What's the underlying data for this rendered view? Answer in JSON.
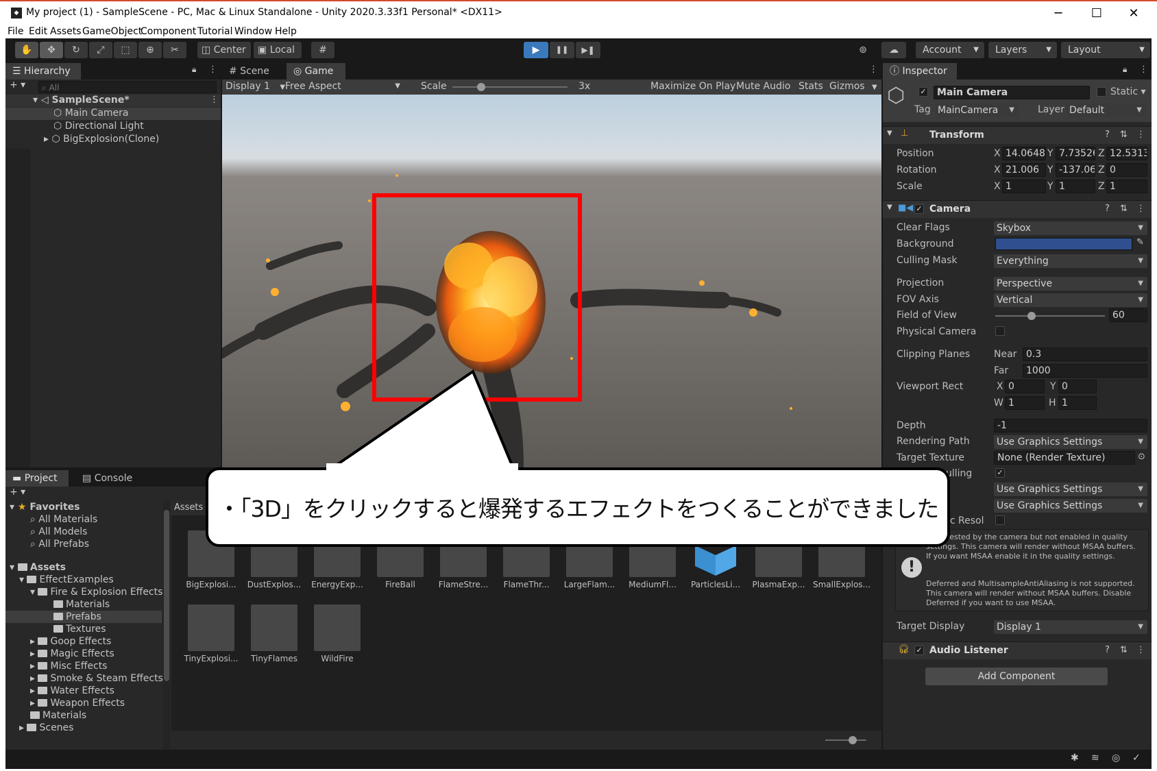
{
  "window": {
    "title": "My project (1) - SampleScene - PC, Mac & Linux Standalone - Unity 2020.3.33f1 Personal* <DX11>",
    "app_icon": "unity-logo-icon",
    "controls": [
      "─",
      "☐",
      "✕"
    ]
  },
  "menu": [
    "File",
    "Edit",
    "Assets",
    "GameObject",
    "Component",
    "Tutorial",
    "Window",
    "Help"
  ],
  "toolbar": {
    "tools": [
      "hand-tool-icon",
      "move-tool-icon",
      "rotate-tool-icon",
      "scale-tool-icon",
      "rect-tool-icon",
      "transform-tool-icon",
      "custom-tool-icon"
    ],
    "pivot": "Center",
    "space": "Local",
    "play_icon": "▶",
    "pause_icon": "❚❚",
    "step_icon": "▶❚",
    "account": "Account",
    "layers": "Layers",
    "layout": "Layout"
  },
  "hierarchy": {
    "tab": "Hierarchy",
    "search_placeholder": "All",
    "scene": "SampleScene*",
    "items": [
      "Main Camera",
      "Directional Light",
      "BigExplosion(Clone)"
    ]
  },
  "game_view": {
    "tabs": [
      "Scene",
      "Game"
    ],
    "display": "Display 1",
    "aspect": "Free Aspect",
    "scale_label": "Scale",
    "scale_value": "3x",
    "scale_level": 0.25,
    "options": [
      "Maximize On Play",
      "Mute Audio",
      "Stats",
      "Gizmos"
    ]
  },
  "project": {
    "tabs": [
      "Project",
      "Console"
    ],
    "favorites_label": "Favorites",
    "favorites": [
      "All Materials",
      "All Models",
      "All Prefabs"
    ],
    "assets_label": "Assets",
    "tree": [
      {
        "label": "EffectExamples",
        "depth": 1
      },
      {
        "label": "Fire & Explosion Effects",
        "depth": 2
      },
      {
        "label": "Materials",
        "depth": 3
      },
      {
        "label": "Prefabs",
        "depth": 3
      },
      {
        "label": "Textures",
        "depth": 3
      },
      {
        "label": "Goop Effects",
        "depth": 2
      },
      {
        "label": "Magic Effects",
        "depth": 2
      },
      {
        "label": "Misc Effects",
        "depth": 2
      },
      {
        "label": "Smoke & Steam Effects",
        "depth": 2
      },
      {
        "label": "Water Effects",
        "depth": 2
      },
      {
        "label": "Weapon Effects",
        "depth": 2
      },
      {
        "label": "Materials",
        "depth": 1
      },
      {
        "label": "Scenes",
        "depth": 1
      }
    ],
    "breadcrumb": "Assets",
    "assets_row1": [
      "BigExplosi...",
      "DustExplos...",
      "EnergyExp...",
      "FireBall",
      "FlameStre...",
      "FlameThr...",
      "LargeFlam...",
      "MediumFl...",
      "ParticlesLi...",
      "PlasmaExp...",
      "SmallExplos..."
    ],
    "assets_row2": [
      "TinyExplosi...",
      "TinyFlames",
      "WildFire"
    ]
  },
  "inspector": {
    "tab": "Inspector",
    "object_name": "Main Camera",
    "static_label": "Static",
    "tag_label": "Tag",
    "tag_value": "MainCamera",
    "layer_label": "Layer",
    "layer_value": "Default",
    "transform": {
      "title": "Transform",
      "position_label": "Position",
      "rotation_label": "Rotation",
      "scale_label": "Scale",
      "position": [
        "14.0648",
        "7.73526",
        "12.5313"
      ],
      "rotation": [
        "21.006",
        "-137.06",
        "0"
      ],
      "scale": [
        "1",
        "1",
        "1"
      ],
      "axes": [
        "X",
        "Y",
        "Z"
      ]
    },
    "camera": {
      "title": "Camera",
      "clear_flags_label": "Clear Flags",
      "clear_flags": "Skybox",
      "background_label": "Background",
      "background_color": "#2f4f8f",
      "culling_mask_label": "Culling Mask",
      "culling_mask": "Everything",
      "projection_label": "Projection",
      "projection": "Perspective",
      "fov_axis_label": "FOV Axis",
      "fov_axis": "Vertical",
      "fov_label": "Field of View",
      "fov": "60",
      "fov_level": 0.33,
      "physical_label": "Physical Camera",
      "clipping_label": "Clipping Planes",
      "near_label": "Near",
      "near": "0.3",
      "far_label": "Far",
      "far": "1000",
      "viewport_label": "Viewport Rect",
      "vx_label": "X",
      "vx": "0",
      "vy_label": "Y",
      "vy": "0",
      "vw_label": "W",
      "vw": "1",
      "vh_label": "H",
      "vh": "1",
      "depth_label": "Depth",
      "depth": "-1",
      "rendering_path_label": "Rendering Path",
      "rendering_path": "Use Graphics Settings",
      "target_texture_label": "Target Texture",
      "target_texture": "None (Render Texture)",
      "occlusion_label_partial": "ulling",
      "hdr_value": "Use Graphics Settings",
      "msaa_value": "Use Graphics Settings",
      "dynamic_label_partial": "ic Resol",
      "warning_1": "s requested by the camera but not enabled in quality settings. This camera will render without MSAA buffers. If you want MSAA enable it in the quality settings.",
      "warning_2": "Deferred and MultisampleAntiAliasing is not supported. This camera will render without MSAA buffers. Disable Deferred if you want to use MSAA.",
      "target_display_label": "Target Display",
      "target_display": "Display 1"
    },
    "audio_listener": "Audio Listener",
    "add_component": "Add Component"
  },
  "callout": {
    "text": "・「3D」をクリックすると爆発するエフェクトをつくることができました"
  },
  "colors": {
    "editor_bg": "#191919",
    "panel_bg": "#282828",
    "highlight_red": "#ff0000",
    "play_blue": "#3a79bb"
  }
}
